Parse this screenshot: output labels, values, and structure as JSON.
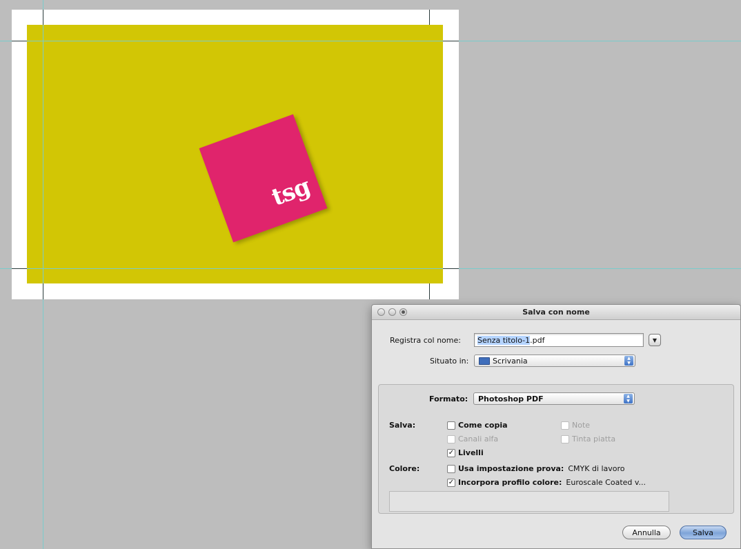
{
  "canvas": {
    "logo_text": "tsg",
    "colors": {
      "background": "#bdbdbd",
      "card": "#d2c605",
      "logo": "#e0246c",
      "guide": "#79cccc"
    }
  },
  "dialog": {
    "title": "Salva con nome",
    "name_label": "Registra col nome:",
    "name_selected": "Senza titolo-1",
    "name_ext": ".pdf",
    "location_label": "Situato in:",
    "location_value": "Scrivania",
    "format_label": "Formato:",
    "format_value": "Photoshop PDF",
    "save_section_label": "Salva:",
    "options": {
      "as_copy": {
        "label": "Come copia",
        "checked": false,
        "enabled": true
      },
      "notes": {
        "label": "Note",
        "checked": false,
        "enabled": false
      },
      "alpha_channels": {
        "label": "Canali alfa",
        "checked": false,
        "enabled": false
      },
      "spot_colors": {
        "label": "Tinta piatta",
        "checked": false,
        "enabled": false
      },
      "layers": {
        "label": "Livelli",
        "checked": true,
        "enabled": true
      }
    },
    "color_section_label": "Colore:",
    "color_options": {
      "proof_setup": {
        "label": "Usa impostazione prova:",
        "value": "CMYK di lavoro",
        "checked": false
      },
      "embed_profile": {
        "label": "Incorpora profilo colore:",
        "value": "Euroscale Coated v...",
        "checked": true
      }
    },
    "cancel_label": "Annulla",
    "save_label": "Salva"
  }
}
